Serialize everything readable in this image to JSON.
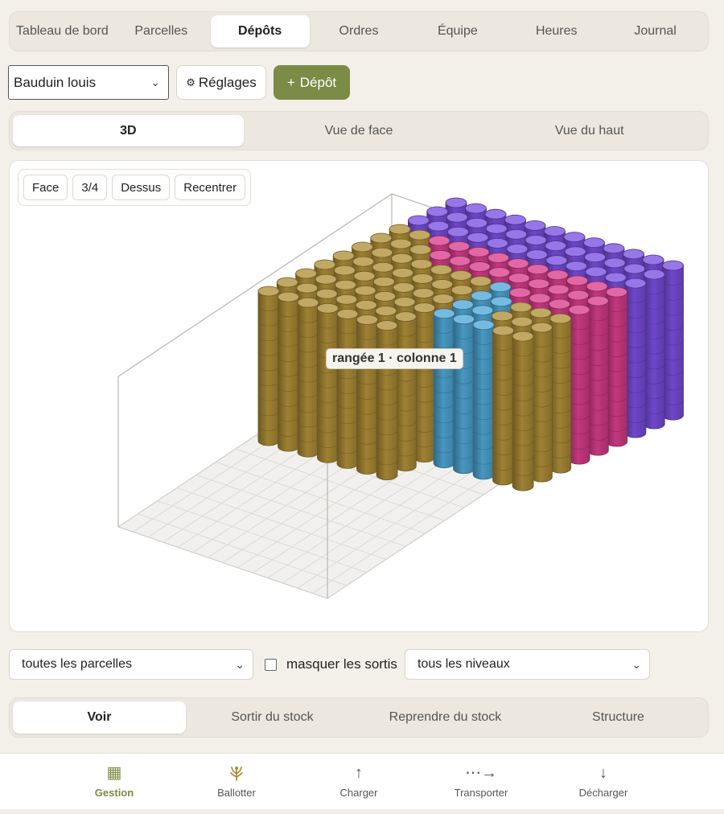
{
  "nav": {
    "items": [
      "Tableau de bord",
      "Parcelles",
      "Dépôts",
      "Ordres",
      "Équipe",
      "Heures",
      "Journal"
    ],
    "active": "Dépôts"
  },
  "toolbar": {
    "user": "Bauduin louis",
    "settings_label": "Réglages",
    "add_label": "Dépôt"
  },
  "view_tabs": {
    "items": [
      "3D",
      "Vue de face",
      "Vue du haut"
    ],
    "active": "3D"
  },
  "viewer": {
    "camera_buttons": [
      "Face",
      "3/4",
      "Dessus",
      "Recentrer"
    ],
    "tooltip": "rangée 1 · colonne 1"
  },
  "filters": {
    "parcel": "toutes les parcelles",
    "hide_out_label": "masquer les sortis",
    "hide_out_checked": false,
    "level": "tous les niveaux"
  },
  "action_tabs": {
    "items": [
      "Voir",
      "Sortir du stock",
      "Reprendre du stock",
      "Structure"
    ],
    "active": "Voir"
  },
  "hint": "",
  "bottom_nav": {
    "items": [
      {
        "label": "Gestion",
        "icon": "grid-icon"
      },
      {
        "label": "Ballotter",
        "icon": "wheat-icon"
      },
      {
        "label": "Charger",
        "icon": "arrow-up-icon"
      },
      {
        "label": "Transporter",
        "icon": "arrow-right-dots-icon"
      },
      {
        "label": "Décharger",
        "icon": "arrow-down-icon"
      }
    ],
    "active": "Gestion"
  },
  "colors": {
    "accent": "#7c8b46",
    "bale_olive": "#b08f38",
    "bale_blue": "#4fa8d6",
    "bale_pink": "#d93d8c",
    "bale_violet": "#7a4fe0"
  }
}
